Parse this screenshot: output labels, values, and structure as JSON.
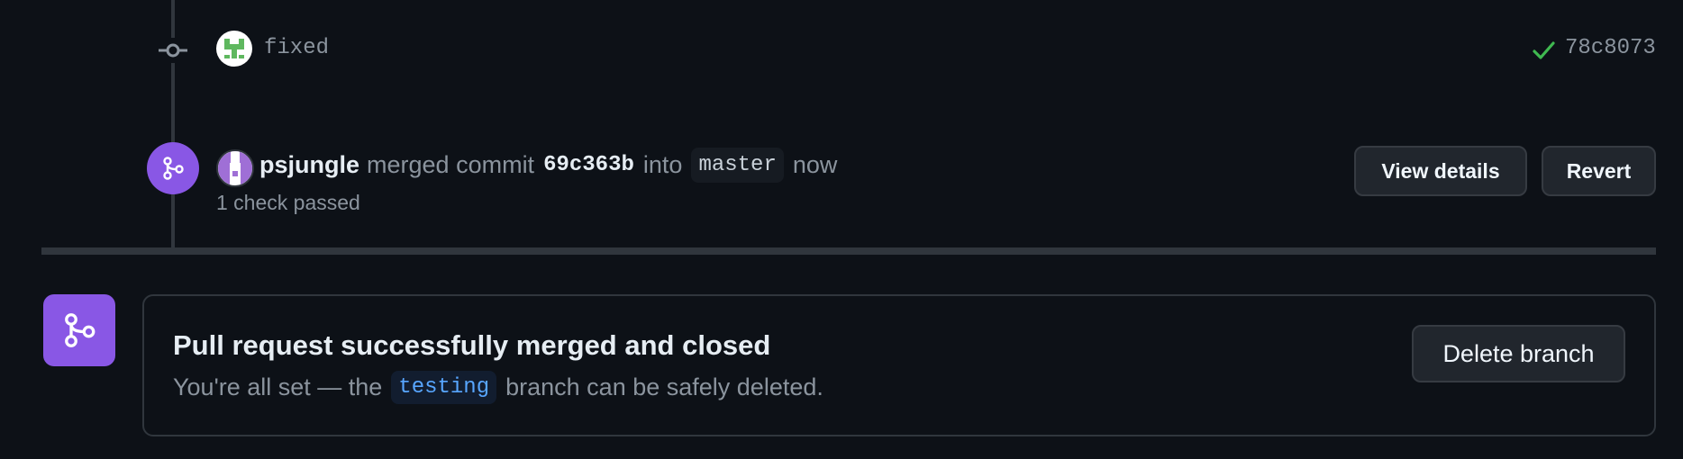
{
  "commit": {
    "message": "fixed",
    "sha": "78c8073",
    "status_icon": "check-icon",
    "author_avatar": "identicon-green"
  },
  "merge_event": {
    "user": "psjungle",
    "text_merged_commit": "merged commit",
    "commit_sha": "69c363b",
    "text_into": "into",
    "target_branch": "master",
    "time": "now",
    "checks": "1 check passed",
    "view_details_label": "View details",
    "revert_label": "Revert",
    "icon": "git-merge-icon",
    "avatar": "identicon-purple"
  },
  "merged_panel": {
    "icon": "git-merge-icon",
    "title": "Pull request successfully merged and closed",
    "desc_prefix": "You're all set — the",
    "branch": "testing",
    "desc_suffix": "branch can be safely deleted.",
    "delete_branch_label": "Delete branch"
  },
  "colors": {
    "background": "#0d1117",
    "merged_purple": "#8957e5",
    "success_green": "#3fb950",
    "link_blue": "#58a6ff",
    "muted_text": "#8b949e",
    "border": "#30363d"
  }
}
